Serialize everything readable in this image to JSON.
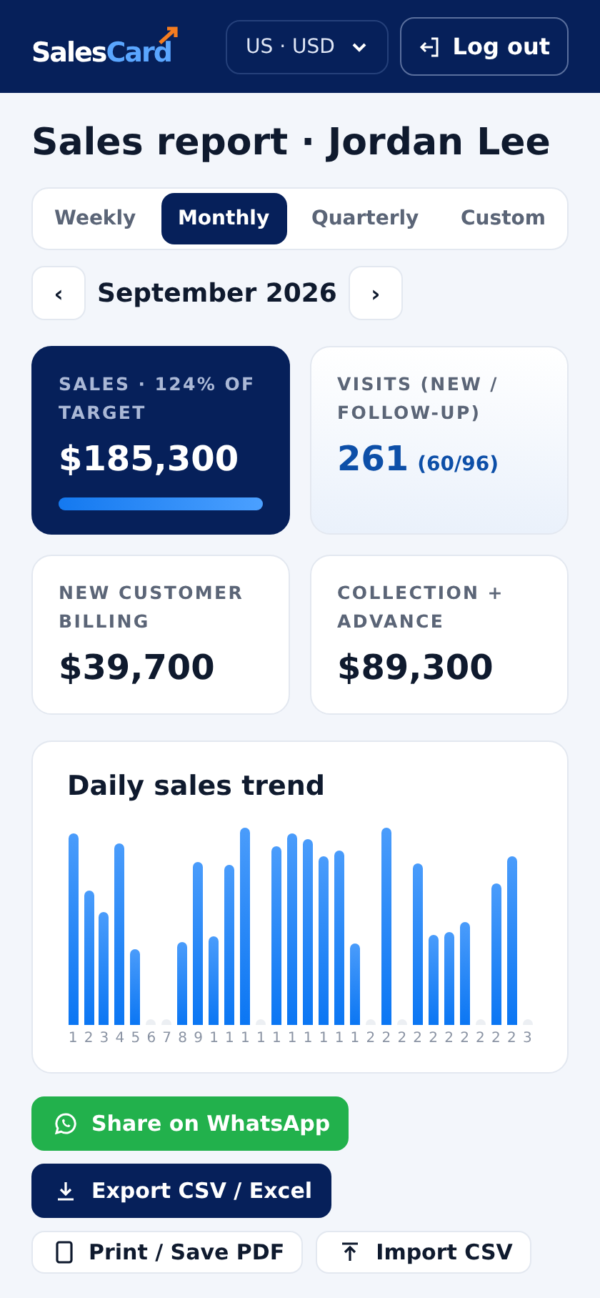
{
  "header": {
    "logo": {
      "part_1": "Sales",
      "part_2": "Card"
    },
    "region_select": {
      "value": "US · USD"
    },
    "logout_button": "Log out"
  },
  "title": "Sales report · Jordan Lee",
  "period_tabs": [
    {
      "label": "Weekly",
      "selected": false
    },
    {
      "label": "Monthly",
      "selected": true
    },
    {
      "label": "Quarterly",
      "selected": false
    },
    {
      "label": "Custom",
      "selected": false
    }
  ],
  "month_nav": {
    "prev": "‹",
    "label": "September 2026",
    "next": "›"
  },
  "stats": [
    {
      "kind": "progress",
      "label": "SALES · 124% OF TARGET",
      "value": "$185,300",
      "level": 1
    },
    {
      "kind": "split",
      "label": "VISITS (NEW / FOLLOW-UP)",
      "value": "261",
      "detail": "(60/96)"
    },
    {
      "kind": "plain",
      "label": "NEW CUSTOMER BILLING",
      "value": "$39,700"
    },
    {
      "kind": "plain",
      "label": "COLLECTION + ADVANCE",
      "value": "$89,300"
    }
  ],
  "trend": {
    "title": "Daily sales trend",
    "day_labels": [
      "1",
      "2",
      "3",
      "4",
      "5",
      "6",
      "7",
      "8",
      "9",
      "1",
      "1",
      "1",
      "1",
      "1",
      "1",
      "1",
      "1",
      "1",
      "1",
      "2",
      "2",
      "2",
      "2",
      "2",
      "2",
      "2",
      "2",
      "2",
      "2",
      "3"
    ]
  },
  "actions": [
    {
      "kind": "whatsapp",
      "label": "Share on WhatsApp"
    },
    {
      "kind": "export",
      "label": "Export CSV / Excel"
    },
    {
      "kind": "print",
      "label": "Print / Save PDF"
    },
    {
      "kind": "import",
      "label": "Import CSV"
    }
  ]
}
